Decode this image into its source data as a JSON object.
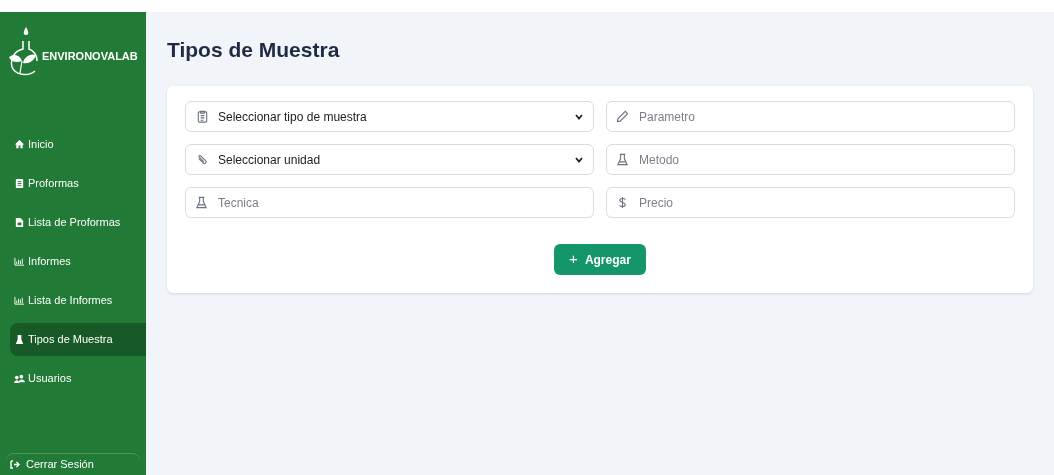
{
  "brand": "ENVIRONOVALAB",
  "nav": [
    {
      "label": "Inicio",
      "selected": false
    },
    {
      "label": "Proformas",
      "selected": false
    },
    {
      "label": "Lista de Proformas",
      "selected": false
    },
    {
      "label": "Informes",
      "selected": false
    },
    {
      "label": "Lista de Informes",
      "selected": false
    },
    {
      "label": "Tipos de Muestra",
      "selected": true
    },
    {
      "label": "Usuarios",
      "selected": false
    }
  ],
  "logout": "Cerrar Sesión",
  "title": "Tipos de Muestra",
  "fields": [
    {
      "kind": "select",
      "value": "Seleccionar tipo de muestra"
    },
    {
      "kind": "input",
      "placeholder": "Parametro"
    },
    {
      "kind": "select",
      "value": "Seleccionar unidad"
    },
    {
      "kind": "input",
      "placeholder": "Metodo"
    },
    {
      "kind": "input",
      "placeholder": "Tecnica"
    },
    {
      "kind": "input",
      "placeholder": "Precio"
    }
  ],
  "add_button": {
    "icon": "+",
    "label": "Agregar"
  }
}
